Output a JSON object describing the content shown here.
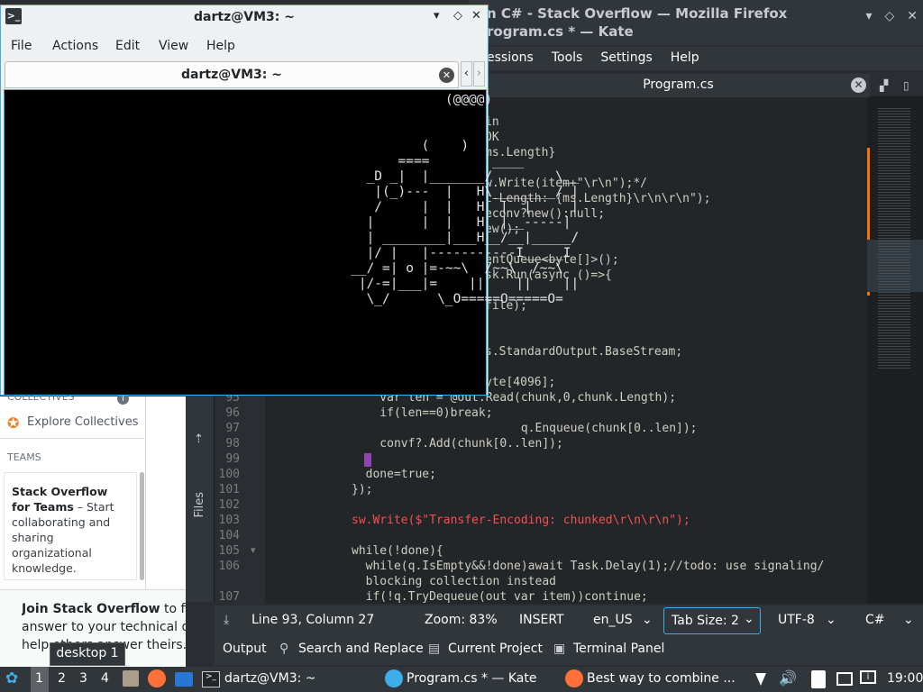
{
  "kate": {
    "title_line1": "n C# - Stack Overflow — Mozilla Firefox",
    "title_line2": "rogram.cs * — Kate",
    "menu": [
      "essions",
      "Tools",
      "Settings",
      "Help"
    ],
    "tab": "Program.cs",
    "sidebar_label": "Files",
    "code_lines": [
      {
        "n": "",
        "t": "in"
      },
      {
        "n": "",
        "t": "OK"
      },
      {
        "n": "",
        "t": "ms.Length}"
      },
      {
        "n": "",
        "t": ""
      },
      {
        "n": "",
        "t": "w.Write(item+\"\\r\\n\");*/"
      },
      {
        "n": "",
        "t": "t-Length: {ms.Length}\\r\\n\\r\\n\");"
      },
      {
        "n": "",
        "t": "econv?new():null;"
      },
      {
        "n": "",
        "t": "ew();"
      },
      {
        "n": "",
        "t": ""
      },
      {
        "n": "",
        "t": "entQueue<byte[]>();"
      },
      {
        "n": "",
        "t": "sk.Run(async ()=>{"
      },
      {
        "n": "",
        "t": ""
      },
      {
        "n": "",
        "t": "file);"
      },
      {
        "n": "",
        "t": ""
      },
      {
        "n": "",
        "t": ""
      },
      {
        "n": "",
        "t": "s.StandardOutput.BaseStream;"
      },
      {
        "n": "",
        "t": ""
      },
      {
        "n": "",
        "t": "yte[4096];"
      },
      {
        "n": "95",
        "t": "    var len = @out.Read(chunk,0,chunk.Length);"
      },
      {
        "n": "96",
        "t": "    if(len==0)break;"
      },
      {
        "n": "97",
        "t": "                        q.Enqueue(chunk[0..len]);"
      },
      {
        "n": "98",
        "t": "    convf?.Add(chunk[0..len]);"
      },
      {
        "n": "99",
        "t": ""
      },
      {
        "n": "100",
        "t": "  done=true;"
      },
      {
        "n": "101",
        "t": "});"
      },
      {
        "n": "102",
        "t": ""
      },
      {
        "n": "103",
        "t": "sw.Write($\"Transfer-Encoding: chunked\\r\\n\\r\\n\");"
      },
      {
        "n": "104",
        "t": ""
      },
      {
        "n": "105",
        "t": "while(!done){"
      },
      {
        "n": "106",
        "t": "  while(q.IsEmpty&&!done)await Task.Delay(1);//todo: use signaling/"
      },
      {
        "n": "",
        "t": "  blocking collection instead"
      },
      {
        "n": "107",
        "t": "  if(!q.TryDequeue(out var item))continue;"
      }
    ],
    "status": {
      "position": "Line 93, Column 27",
      "zoom": "Zoom: 83%",
      "mode": "INSERT",
      "lang": "en_US",
      "tabsize": "Tab Size: 2",
      "encoding": "UTF-8",
      "syntax": "C#"
    },
    "toolviews": [
      "Output",
      "Search and Replace",
      "Current Project",
      "Terminal Panel"
    ]
  },
  "firefox": {
    "collectives_heading": "COLLECTIVES",
    "explore": "Explore Collectives",
    "teams": "TEAMS",
    "teams_bold": "Stack Overflow for Teams",
    "teams_text": " – Start collaborating and sharing organizational knowledge.",
    "join_bold": "Join Stack Overflow",
    "join_text": " to fin",
    "answer_text": "answer to your technical qu",
    "help_text": "help others answer theirs."
  },
  "konsole": {
    "title": "dartz@VM3: ~",
    "menu": [
      "File",
      "Actions",
      "Edit",
      "View",
      "Help"
    ],
    "tab": "dartz@VM3: ~",
    "screen": "                                                        (@@@@)\n\n\n                                                     (    )\n                                                  ====        ____\n                                              _D _|  |_______/        \\__\n                                               |(_)---  |   H\\________/ |\n                                               /     |  |   H  |  |     |\n                                              |      |  |   H  |__-----|\n                                              | ________|___H__/__|_____/\n                                              |/ |   |-----------I_____I\n                                            __/ =| o |=-~~\\  /~~\\  /~~\\\n                                             |/-=|___|=    ||    ||    ||\n                                              \\_/      \\_O=====O=====O="
  },
  "taskbar": {
    "desktops": [
      "1",
      "2",
      "3",
      "4"
    ],
    "tooltip": "desktop 1",
    "tasks": [
      "dartz@VM3: ~",
      "Program.cs * — Kate",
      "Best way to combine ..."
    ],
    "clock": "19:00"
  },
  "colors": {
    "accent": "#3daee9",
    "keyword": "#fcfcfc",
    "string": "#f44f4f",
    "type": "#2980b9",
    "function": "#8e44ad"
  }
}
